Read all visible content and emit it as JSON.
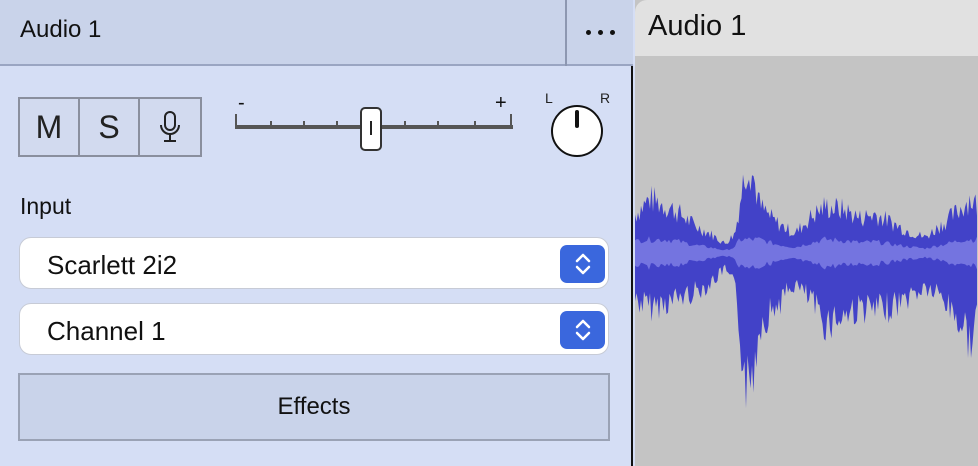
{
  "track": {
    "name": "Audio 1",
    "more_icon": "ellipsis-icon",
    "buttons": [
      {
        "id": "mute",
        "label": "M"
      },
      {
        "id": "solo",
        "label": "S"
      },
      {
        "id": "record",
        "icon": "microphone-icon"
      }
    ],
    "volume": {
      "minus_label": "-",
      "plus_label": "+",
      "level": 0.5
    },
    "pan": {
      "left_label": "L",
      "right_label": "R",
      "value": 0.0
    },
    "input": {
      "label": "Input",
      "device": "Scarlett 2i2",
      "channel": "Channel 1"
    },
    "effects_label": "Effects"
  },
  "clip": {
    "name": "Audio 1",
    "waveform_color": "#4242c8",
    "waveform_inner_color": "#7474e0"
  },
  "colors": {
    "panel_bg": "#d5def5",
    "header_bg": "#c9d3ea",
    "accent": "#3a67dd",
    "clip_bg": "#c4c4c4"
  }
}
